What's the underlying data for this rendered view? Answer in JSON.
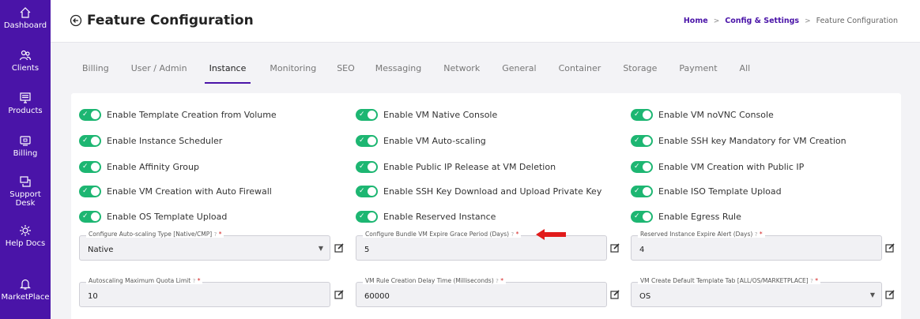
{
  "sidebar": {
    "items": [
      {
        "label": "Dashboard",
        "icon": "home-icon"
      },
      {
        "label": "Clients",
        "icon": "users-icon"
      },
      {
        "label": "Products",
        "icon": "monitor-icon"
      },
      {
        "label": "Billing",
        "icon": "card-icon"
      },
      {
        "label": "Support Desk",
        "icon": "chat-icon"
      },
      {
        "label": "Help Docs",
        "icon": "gear-icon"
      },
      {
        "label": "MarketPlace",
        "icon": "bell-icon"
      }
    ]
  },
  "header": {
    "title": "Feature Configuration",
    "breadcrumb": {
      "home": "Home",
      "config": "Config & Settings",
      "current": "Feature Configuration"
    }
  },
  "tabs": [
    "Billing",
    "User / Admin",
    "Instance",
    "Monitoring",
    "SEO",
    "Messaging",
    "Network",
    "General",
    "Container",
    "Storage",
    "Payment",
    "All"
  ],
  "active_tab": "Instance",
  "toggles": [
    [
      "Enable Template Creation from Volume",
      "Enable VM Native Console",
      "Enable VM noVNC Console"
    ],
    [
      "Enable Instance Scheduler",
      "Enable VM Auto-scaling",
      "Enable SSH key Mandatory for VM Creation"
    ],
    [
      "Enable Affinity Group",
      "Enable Public IP Release at VM Deletion",
      "Enable VM Creation with Public IP"
    ],
    [
      "Enable VM Creation with Auto Firewall",
      "Enable SSH Key Download and Upload Private Key",
      "Enable ISO Template Upload"
    ],
    [
      "Enable OS Template Upload",
      "Enable Reserved Instance",
      "Enable Egress Rule"
    ]
  ],
  "fields": [
    {
      "label": "Configure Auto-scaling Type [Native/CMP]",
      "value": "Native",
      "type": "select"
    },
    {
      "label": "Configure Bundle VM Expire Grace Period (Days)",
      "value": "5",
      "type": "text"
    },
    {
      "label": "Reserved Instance Expire Alert (Days)",
      "value": "4",
      "type": "text"
    },
    {
      "label": "Autoscaling Maximum Quota Limit",
      "value": "10",
      "type": "text"
    },
    {
      "label": "VM Rule Creation Delay Time (Milliseconds)",
      "value": "60000",
      "type": "text"
    },
    {
      "label": "VM Create Default Template Tab [ALL/OS/MARKETPLACE]",
      "value": "OS",
      "type": "select"
    }
  ],
  "glyphs": {
    "req": "*",
    "help": "?",
    "check": "✓",
    "caret": "▼",
    "sep": ">"
  },
  "colors": {
    "primary": "#4a14a8",
    "toggle_on": "#1db672",
    "arrow": "#e11b1b",
    "required": "#d32020"
  }
}
